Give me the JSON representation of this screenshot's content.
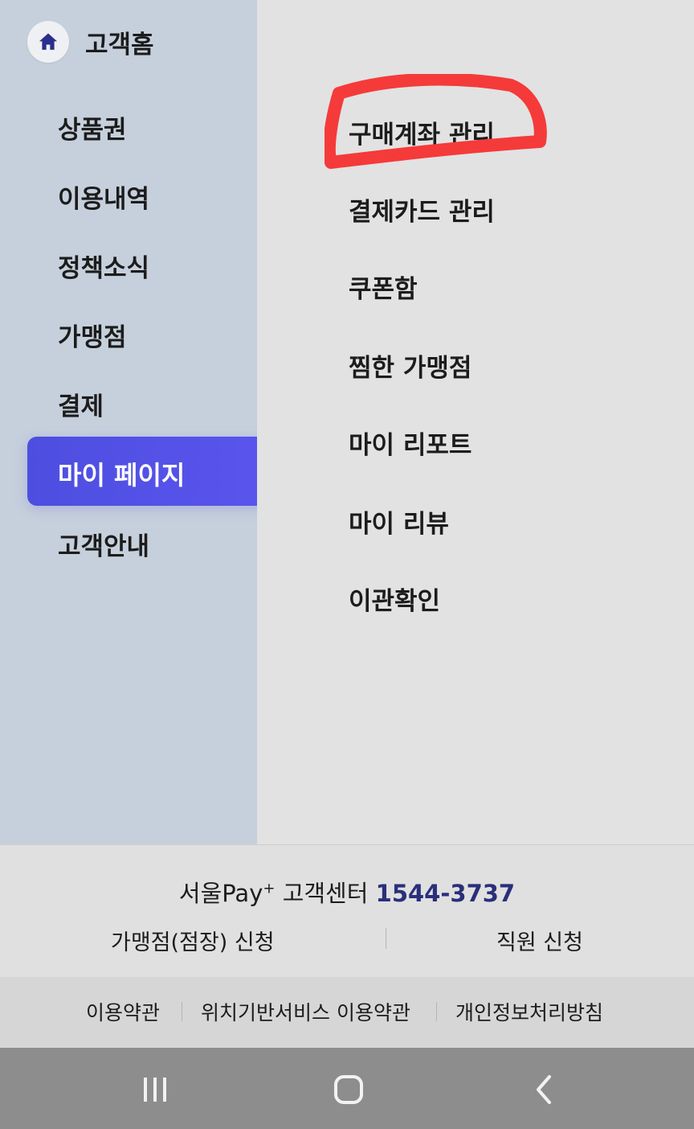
{
  "sidebar": {
    "home_label": "고객홈",
    "items": [
      {
        "label": "상품권"
      },
      {
        "label": "이용내역"
      },
      {
        "label": "정책소식"
      },
      {
        "label": "가맹점"
      },
      {
        "label": "결제"
      },
      {
        "label": "마이 페이지"
      },
      {
        "label": "고객안내"
      }
    ],
    "active_index": 5
  },
  "submenu": {
    "items": [
      {
        "label": "구매계좌 관리"
      },
      {
        "label": "결제카드 관리"
      },
      {
        "label": "쿠폰함"
      },
      {
        "label": "찜한 가맹점"
      },
      {
        "label": "마이 리포트"
      },
      {
        "label": "마이 리뷰"
      },
      {
        "label": "이관확인"
      }
    ],
    "highlighted_index": 0
  },
  "footer": {
    "cs_brand": "서울Pay",
    "cs_superscript": "+",
    "cs_label": "고객센터",
    "cs_phone": "1544-3737",
    "apply_merchant": "가맹점(점장) 신청",
    "apply_staff": "직원 신청"
  },
  "legal": {
    "terms": "이용약관",
    "location_terms": "위치기반서비스 이용약관",
    "privacy": "개인정보처리방침"
  },
  "colors": {
    "active_item": "#5050e6",
    "sidebar_bg": "#c6d0dc",
    "content_bg": "#e2e2e2",
    "annotation_red": "#f53a3a",
    "phone_color": "#2a2f7a"
  },
  "icons": {
    "home": "home-icon",
    "nav_recents": "recents-icon",
    "nav_home": "nav-home-icon",
    "nav_back": "back-icon"
  }
}
